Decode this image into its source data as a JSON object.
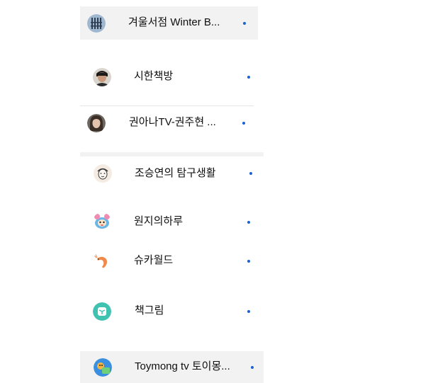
{
  "channels": [
    {
      "name": "겨울서점 Winter B...",
      "avatar": "bookshelf-avatar-icon",
      "highlight": true
    },
    {
      "name": "시한책방",
      "avatar": "man-portrait-avatar-icon",
      "highlight": false
    },
    {
      "name": "권아나TV-권주현 ...",
      "avatar": "woman-portrait-avatar-icon",
      "highlight": false
    },
    {
      "name": "조승연의 탐구생활",
      "avatar": "drawn-face-avatar-icon",
      "highlight": false
    },
    {
      "name": "원지의하루",
      "avatar": "cartoon-character-avatar-icon",
      "highlight": false
    },
    {
      "name": "슈카월드",
      "avatar": "shrimp-avatar-icon",
      "highlight": false
    },
    {
      "name": "책그림",
      "avatar": "book-logo-avatar-icon",
      "highlight": false
    },
    {
      "name": "Toymong tv 토이몽...",
      "avatar": "toy-avatar-icon",
      "highlight": true
    }
  ],
  "colors": {
    "new_content_dot": "#1a62d6",
    "highlight_bg": "#f2f2f2"
  }
}
